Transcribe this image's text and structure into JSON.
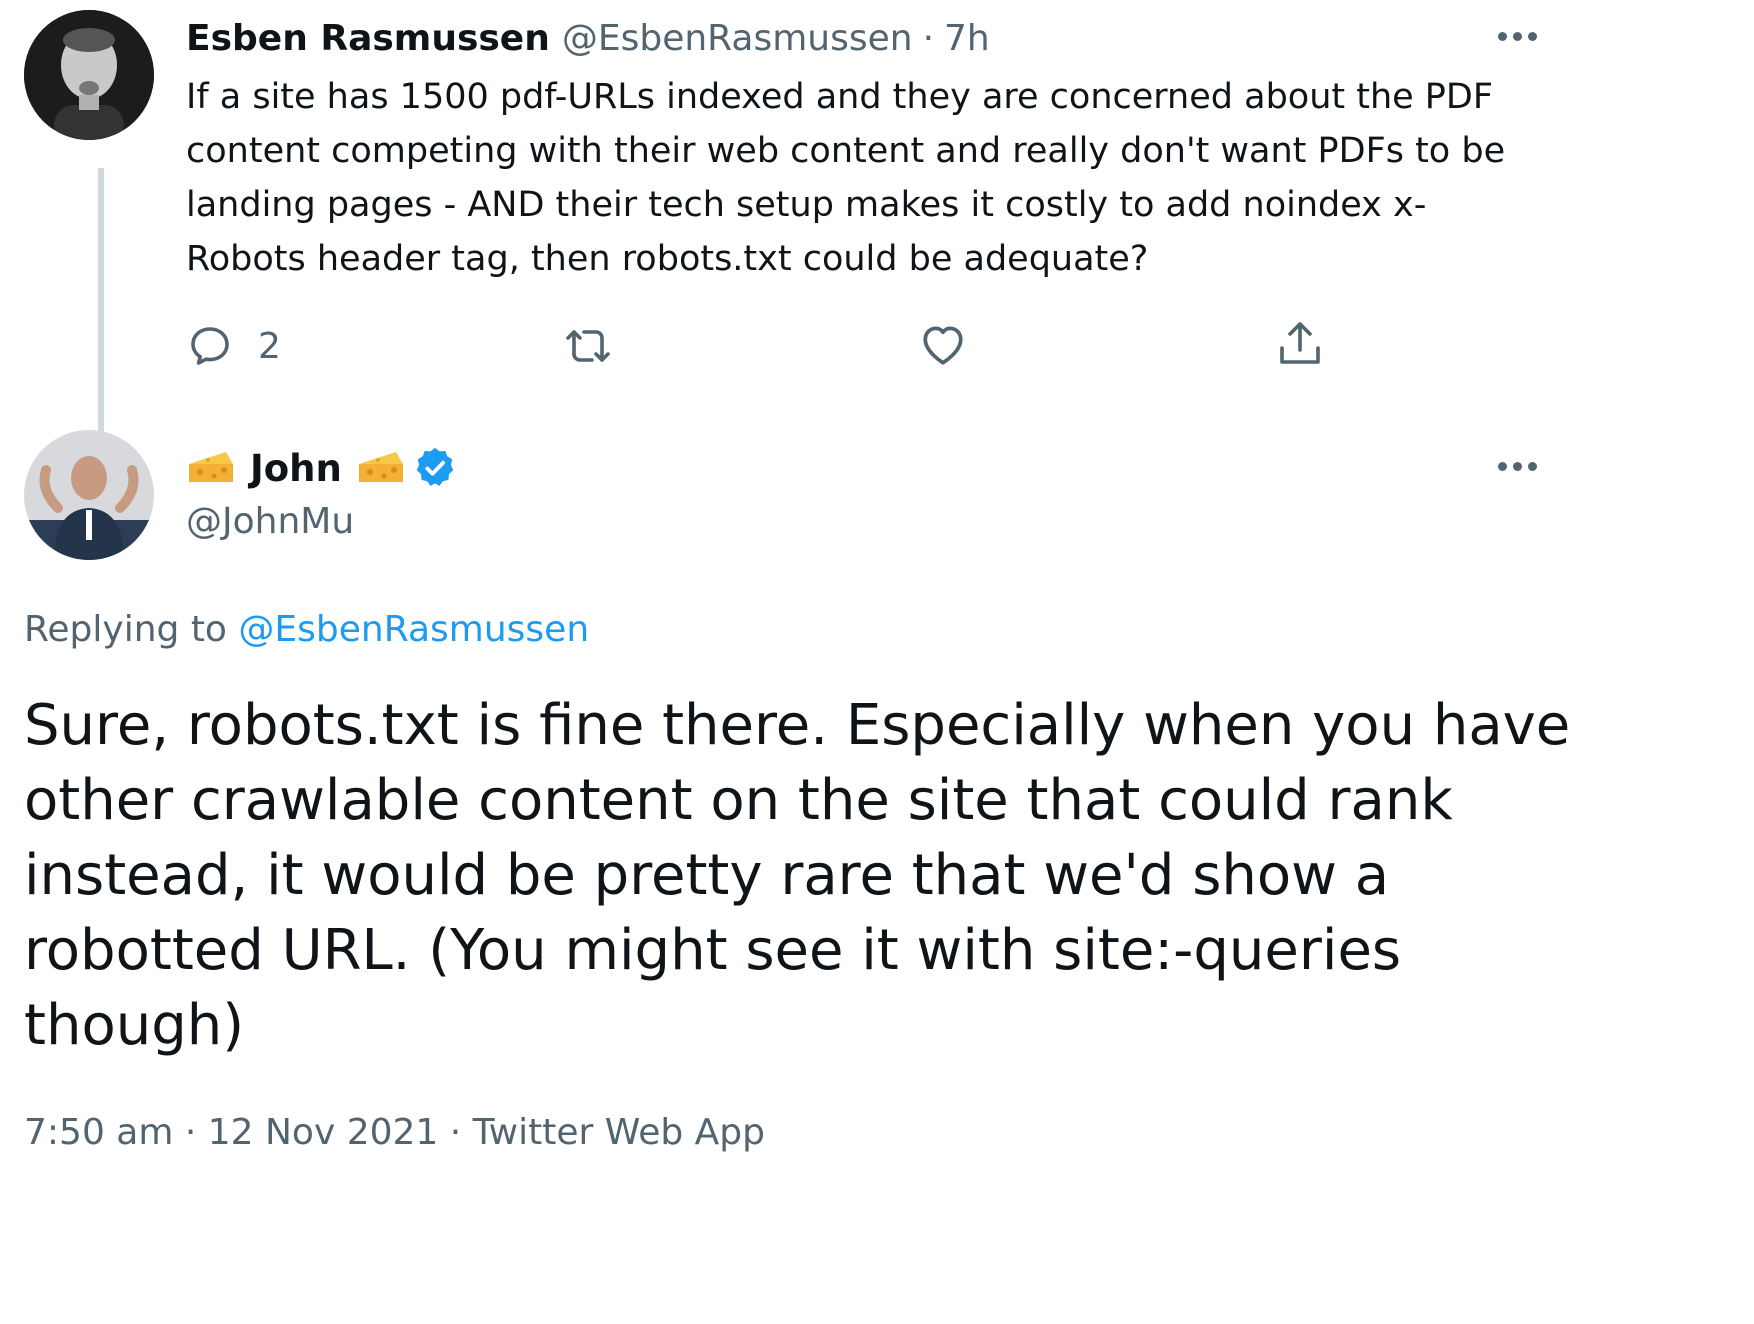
{
  "first_tweet": {
    "display_name": "Esben Rasmussen",
    "handle": "@EsbenRasmussen",
    "separator": "·",
    "time": "7h",
    "text_lines": [
      "If a site has 1500 pdf-URLs indexed and they are concerned about the PDF",
      "content competing with their web content and really don't want PDFs to be",
      "landing pages - AND their tech setup makes it costly to add noindex x-",
      "Robots header tag, then robots.txt could be adequate?"
    ],
    "reply_count": "2",
    "icons": {
      "reply": "reply-icon",
      "retweet": "retweet-icon",
      "like": "heart-icon",
      "share": "share-icon",
      "more": "more-icon"
    }
  },
  "reply_tweet": {
    "display_name": "John",
    "name_emoji": "cheese-wedge-icon",
    "verified": "verified-badge-icon",
    "handle": "@JohnMu",
    "replying_prefix": "Replying to",
    "replying_to": "@EsbenRasmussen",
    "text_lines": [
      "Sure, robots.txt is fine there. Especially when you have",
      "other crawlable content on the site that could rank",
      "instead, it would be pretty rare that we'd show a",
      "robotted URL. (You might see it with site:-queries",
      "though)"
    ],
    "timestamp": "7:50 am · 12 Nov 2021 · Twitter Web App"
  },
  "colors": {
    "text": "#0f1419",
    "muted": "#536471",
    "link": "#1d9bf0",
    "verified": "#1d9bf0",
    "thread_line": "#cfd9de"
  }
}
